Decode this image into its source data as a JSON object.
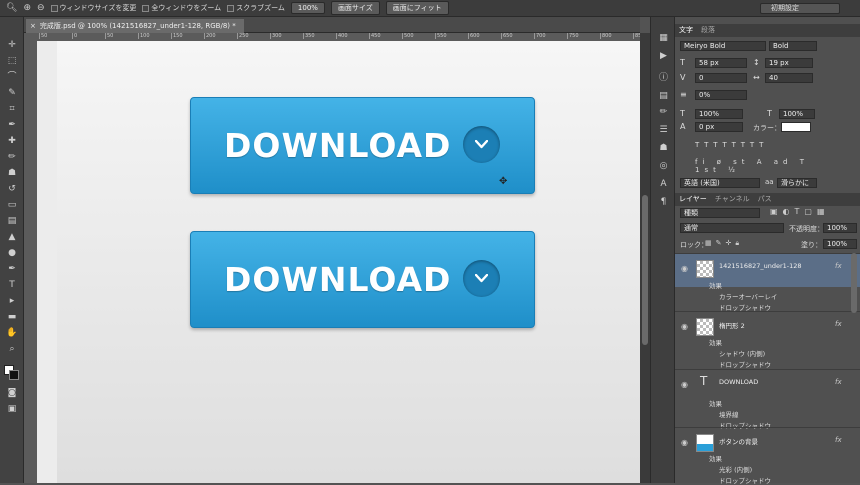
{
  "options_bar": {
    "resize_windows": "ウィンドウサイズを変更",
    "zoom_all": "全ウィンドウをズーム",
    "scrubby_zoom": "スクラブズーム",
    "zoom_value": "100%",
    "fit_screen": "画面サイズ",
    "fill_screen": "画面にフィット",
    "workspace": "初期設定"
  },
  "document": {
    "tab_title": "完成版.psd @ 100% (1421516827_under1-128, RGB/8) *"
  },
  "ruler": {
    "ticks": [
      "50",
      "0",
      "50",
      "100",
      "150",
      "200",
      "250",
      "300",
      "350",
      "400",
      "450",
      "500",
      "550",
      "600",
      "650",
      "700",
      "750",
      "800",
      "850"
    ]
  },
  "canvas": {
    "button1_label": "DOWNLOAD",
    "button2_label": "DOWNLOAD"
  },
  "char_panel": {
    "tab_character": "文字",
    "tab_paragraph": "段落",
    "font_family": "Meiryo Bold",
    "font_style": "Bold",
    "font_size": "58 px",
    "leading": "19 px",
    "kerning": "0",
    "tracking": "40",
    "tsume": "0%",
    "vscale": "100%",
    "hscale": "100%",
    "baseline": "0 px",
    "color_label": "カラー：",
    "language": "英語 (米国)",
    "antialias": "滑らかに"
  },
  "layers_panel": {
    "tab_layers": "レイヤー",
    "tab_channels": "チャンネル",
    "tab_paths": "パス",
    "filter_kind": "種類",
    "blend_mode": "通常",
    "opacity_label": "不透明度：",
    "opacity_value": "100%",
    "lock_label": "ロック：",
    "fill_label": "塗り：",
    "fill_value": "100%",
    "layers": [
      {
        "name": "1421516827_under1-128",
        "effects_label": "効果",
        "effects": [
          "カラーオーバーレイ",
          "ドロップシャドウ"
        ]
      },
      {
        "name": "楕円形 2",
        "effects_label": "効果",
        "effects": [
          "シャドウ (内側)",
          "ドロップシャドウ"
        ]
      },
      {
        "name": "DOWNLOAD",
        "effects_label": "効果",
        "effects": [
          "境界線",
          "ドロップシャドウ"
        ]
      },
      {
        "name": "ボタンの背景",
        "effects_label": "効果",
        "effects": [
          "光彩 (内側)",
          "ドロップシャドウ"
        ]
      }
    ],
    "fx": "fx"
  },
  "colors": {
    "accent": "#2a9fd8",
    "layer_selected": "#5b6e87"
  }
}
